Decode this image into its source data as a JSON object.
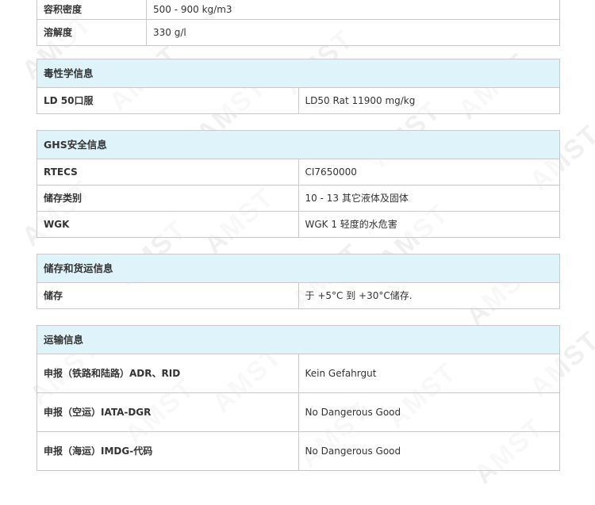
{
  "watermark": "AMST",
  "sections": {
    "physical": {
      "rows": [
        {
          "label": "容积密度",
          "value": "500 - 900 kg/m3"
        },
        {
          "label": "溶解度",
          "value": "330 g/l"
        }
      ]
    },
    "toxicity": {
      "title": "毒性学信息",
      "rows": [
        {
          "label": "LD 50口服",
          "value": "LD50 Rat 11900 mg/kg"
        }
      ]
    },
    "ghs": {
      "title": "GHS安全信息",
      "rows": [
        {
          "label": "RTECS",
          "value": "CI7650000"
        },
        {
          "label": "储存类别",
          "value": "10 - 13 其它液体及固体"
        },
        {
          "label": "WGK",
          "value": "WGK 1 轻度的水危害"
        }
      ]
    },
    "storage": {
      "title": "储存和货运信息",
      "rows": [
        {
          "label": "储存",
          "value": "于 +5°C 到 +30°C储存."
        }
      ]
    },
    "transport": {
      "title": "运输信息",
      "rows": [
        {
          "label": "申报（铁路和陆路）ADR、RID",
          "value": "Kein Gefahrgut"
        },
        {
          "label": "申报（空运）IATA-DGR",
          "value": "No Dangerous Good"
        },
        {
          "label": "申报（海运）IMDG-代码",
          "value": "No Dangerous Good"
        }
      ]
    }
  }
}
